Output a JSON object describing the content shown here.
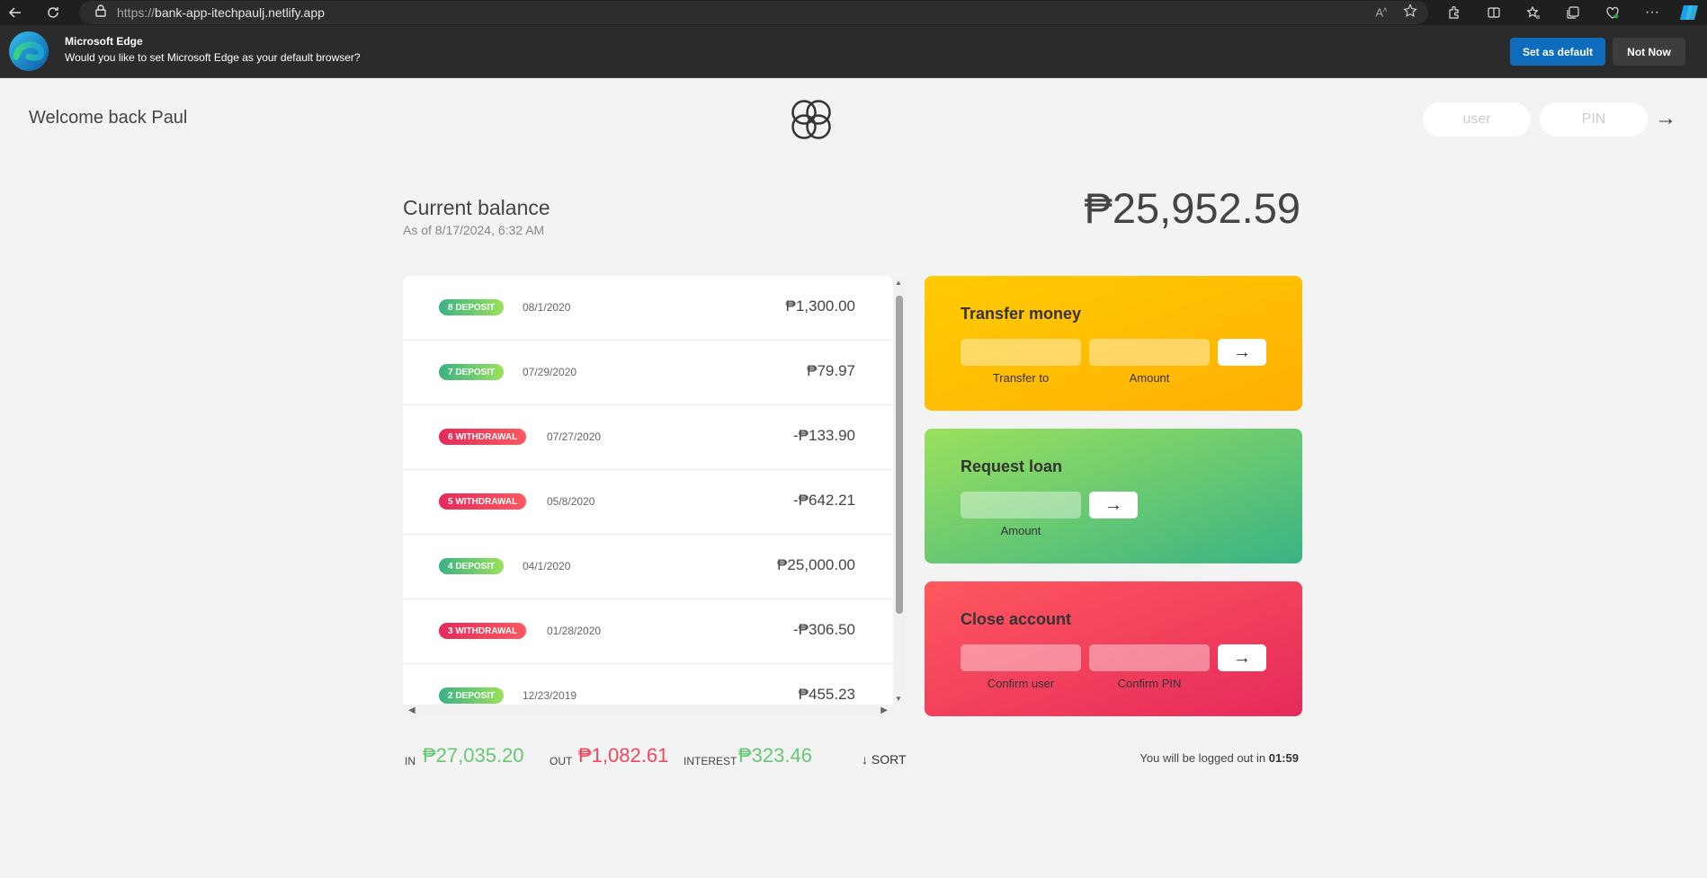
{
  "browser": {
    "url_protocol": "https://",
    "url_host": "bank-app-itechpaulj.netlify.app",
    "infobar": {
      "title": "Microsoft Edge",
      "message": "Would you like to set Microsoft Edge as your default browser?",
      "set_default_label": "Set as default",
      "not_now_label": "Not Now"
    }
  },
  "header": {
    "welcome": "Welcome back Paul",
    "user_placeholder": "user",
    "pin_placeholder": "PIN",
    "login_arrow": "→"
  },
  "balance": {
    "label": "Current balance",
    "date": "As of 8/17/2024, 6:32 AM",
    "value": "₱25,952.59"
  },
  "movements": [
    {
      "type_label": "8 DEPOSIT",
      "kind": "deposit",
      "date": "08/1/2020",
      "value": "₱1,300.00"
    },
    {
      "type_label": "7 DEPOSIT",
      "kind": "deposit",
      "date": "07/29/2020",
      "value": "₱79.97"
    },
    {
      "type_label": "6 WITHDRAWAL",
      "kind": "withdrawal",
      "date": "07/27/2020",
      "value": "-₱133.90"
    },
    {
      "type_label": "5 WITHDRAWAL",
      "kind": "withdrawal",
      "date": "05/8/2020",
      "value": "-₱642.21"
    },
    {
      "type_label": "4 DEPOSIT",
      "kind": "deposit",
      "date": "04/1/2020",
      "value": "₱25,000.00"
    },
    {
      "type_label": "3 WITHDRAWAL",
      "kind": "withdrawal",
      "date": "01/28/2020",
      "value": "-₱306.50"
    },
    {
      "type_label": "2 DEPOSIT",
      "kind": "deposit",
      "date": "12/23/2019",
      "value": "₱455.23"
    }
  ],
  "operations": {
    "transfer": {
      "title": "Transfer money",
      "to_label": "Transfer to",
      "amount_label": "Amount",
      "button": "→"
    },
    "loan": {
      "title": "Request loan",
      "amount_label": "Amount",
      "button": "→"
    },
    "close": {
      "title": "Close account",
      "user_label": "Confirm user",
      "pin_label": "Confirm PIN",
      "button": "→"
    }
  },
  "summary": {
    "in_label": "In",
    "in_value": "₱27,035.20",
    "out_label": "Out",
    "out_value": "₱1,082.61",
    "interest_label": "Interest",
    "interest_value": "₱323.46",
    "sort_label": "↓ SORT",
    "logout_text": "You will be logged out in ",
    "logout_time": "01:59"
  },
  "colors": {
    "deposit": "#66c873",
    "withdrawal": "#f5465d",
    "edge_blue": "#0f6cbd"
  }
}
